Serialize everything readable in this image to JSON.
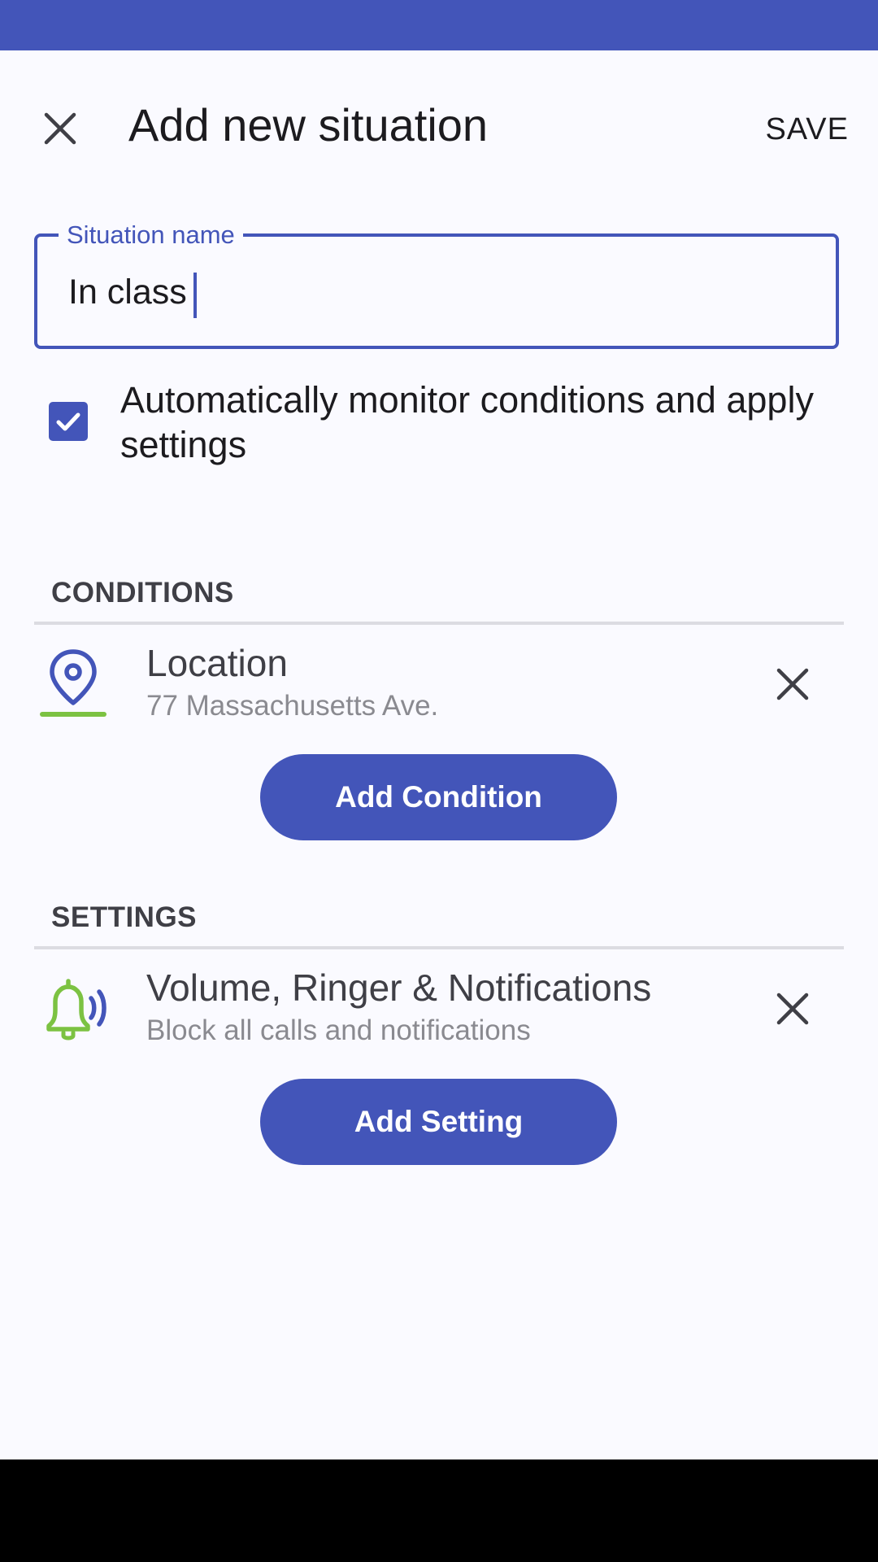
{
  "header": {
    "title": "Add new situation",
    "save_label": "SAVE"
  },
  "situation_name": {
    "label": "Situation name",
    "value": "In class"
  },
  "auto_monitor": {
    "label": "Automatically monitor conditions and apply settings",
    "checked": true
  },
  "conditions": {
    "header": "CONDITIONS",
    "items": [
      {
        "title": "Location",
        "subtitle": "77 Massachusetts Ave.",
        "icon": "location-pin-icon"
      }
    ],
    "add_label": "Add Condition"
  },
  "settings": {
    "header": "SETTINGS",
    "items": [
      {
        "title": "Volume, Ringer & Notifications",
        "subtitle": "Block all calls and notifications",
        "icon": "ringer-bell-icon"
      }
    ],
    "add_label": "Add Setting"
  },
  "colors": {
    "primary": "#4355b9",
    "accent_green": "#7cc242",
    "background": "#fafaff"
  }
}
